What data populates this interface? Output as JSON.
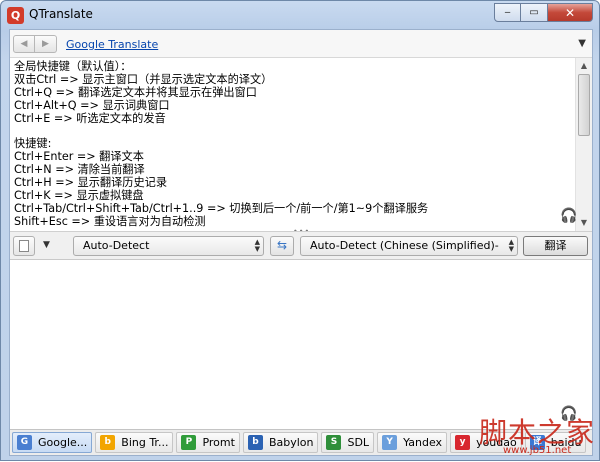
{
  "window": {
    "title": "QTranslate"
  },
  "app_icon": {
    "glyph": "Q",
    "color": "#d23b2a"
  },
  "titlebar": {
    "minimize": "‒",
    "maximize": "▭",
    "close": "✕"
  },
  "navbar": {
    "back": "◀",
    "forward": "▶",
    "service_link": "Google Translate",
    "menu": "▼"
  },
  "result_text": "全局快捷键（默认值）：\n双击Ctrl => 显示主窗口（并显示选定文本的译文）\nCtrl+Q => 翻译选定文本并将其显示在弹出窗口\nCtrl+Alt+Q => 显示词典窗口\nCtrl+E => 听选定文本的发音\n\n快捷键:\nCtrl+Enter => 翻译文本\nCtrl+N => 清除当前翻译\nCtrl+H => 显示翻译历史记录\nCtrl+K => 显示虚拟键盘\nCtrl+Tab/Ctrl+Shift+Tab/Ctrl+1..9 => 切换到后一个/前一个/第1~9个翻译服务\nShift+Esc => 重设语言对为自动检测",
  "toolbar": {
    "menu": "▼",
    "source_language": "Auto-Detect",
    "swap": "⇆",
    "target_language": "Auto-Detect (Chinese (Simplified)-English)",
    "translate_label": "翻译"
  },
  "splitter": "•••",
  "tabs": [
    {
      "label": "Google...",
      "icon": "G",
      "color": "#4a7fd1",
      "active": true
    },
    {
      "label": "Bing Tr...",
      "icon": "b",
      "color": "#f2a500",
      "active": false
    },
    {
      "label": "Promt",
      "icon": "P",
      "color": "#2f9c3a",
      "active": false
    },
    {
      "label": "Babylon",
      "icon": "b",
      "color": "#2b62b3",
      "active": false
    },
    {
      "label": "SDL",
      "icon": "S",
      "color": "#2f8f3a",
      "active": false
    },
    {
      "label": "Yandex",
      "icon": "Y",
      "color": "#6b9fdc",
      "active": false
    },
    {
      "label": "youdao",
      "icon": "y",
      "color": "#d8272f",
      "active": false
    },
    {
      "label": "baidu",
      "icon": "译",
      "color": "#3a78d3",
      "active": false
    }
  ],
  "watermark": {
    "text": "脚本之家",
    "url": "www.jb51.net"
  }
}
